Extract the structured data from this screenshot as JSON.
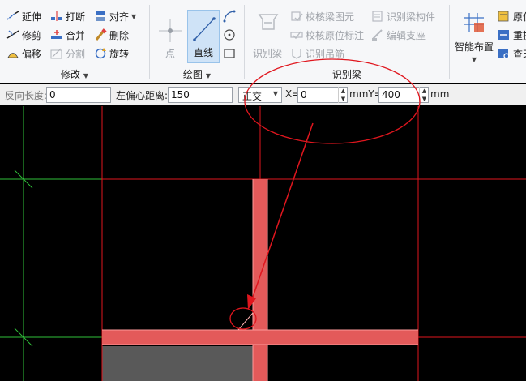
{
  "ribbon": {
    "modify": {
      "title": "修改",
      "items": [
        {
          "label": "延伸",
          "icon": "extend-icon",
          "enabled": true
        },
        {
          "label": "打断",
          "icon": "break-icon",
          "enabled": true
        },
        {
          "label": "对齐",
          "icon": "align-icon",
          "enabled": true
        },
        {
          "label": "修剪",
          "icon": "trim-icon",
          "enabled": true
        },
        {
          "label": "合并",
          "icon": "merge-icon",
          "enabled": true
        },
        {
          "label": "删除",
          "icon": "delete-icon",
          "enabled": true
        },
        {
          "label": "偏移",
          "icon": "offset-icon",
          "enabled": true
        },
        {
          "label": "分割",
          "icon": "split-icon",
          "enabled": false
        },
        {
          "label": "旋转",
          "icon": "rotate-icon",
          "enabled": true
        }
      ]
    },
    "draw": {
      "title": "绘图",
      "point_label": "点",
      "line_label": "直线"
    },
    "recognize_beam": {
      "title": "识别梁",
      "big_button": "识别梁",
      "items": [
        {
          "label": "校核梁图元",
          "enabled": false
        },
        {
          "label": "识别梁构件",
          "enabled": false
        },
        {
          "label": "校核原位标注",
          "enabled": false
        },
        {
          "label": "编辑支座",
          "enabled": false
        },
        {
          "label": "识别吊筋",
          "enabled": false
        }
      ]
    },
    "smart": {
      "big_button": "智能布置",
      "items": [
        "原位",
        "重提",
        "查改"
      ]
    }
  },
  "toolbar": {
    "reverse_length_label": "反向长度:",
    "reverse_length_value": "0",
    "left_offset_label": "左偏心距离:",
    "left_offset_value": "150",
    "mode_value": "正交",
    "x_label": "X=",
    "x_value": "0",
    "y_label": "mmY=",
    "y_value": "400",
    "unit_label": "mm"
  },
  "colors": {
    "canvas_bg": "#000000",
    "axis_red": "#e0161e",
    "axis_green": "#2fbf3a",
    "beam_fill": "#e35a5a",
    "slab_fill": "#595959",
    "annotation": "#e0161e"
  }
}
